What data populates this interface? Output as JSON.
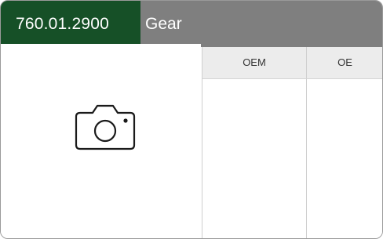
{
  "header": {
    "part_number": "760.01.2900",
    "part_name": "Gear"
  },
  "image_panel": {
    "icon": "camera-icon"
  },
  "table": {
    "columns": [
      "OEM",
      "OE"
    ]
  },
  "colors": {
    "part_number_background": "#165027",
    "header_background": "#7f7f7f",
    "table_header_background": "#ececec"
  }
}
